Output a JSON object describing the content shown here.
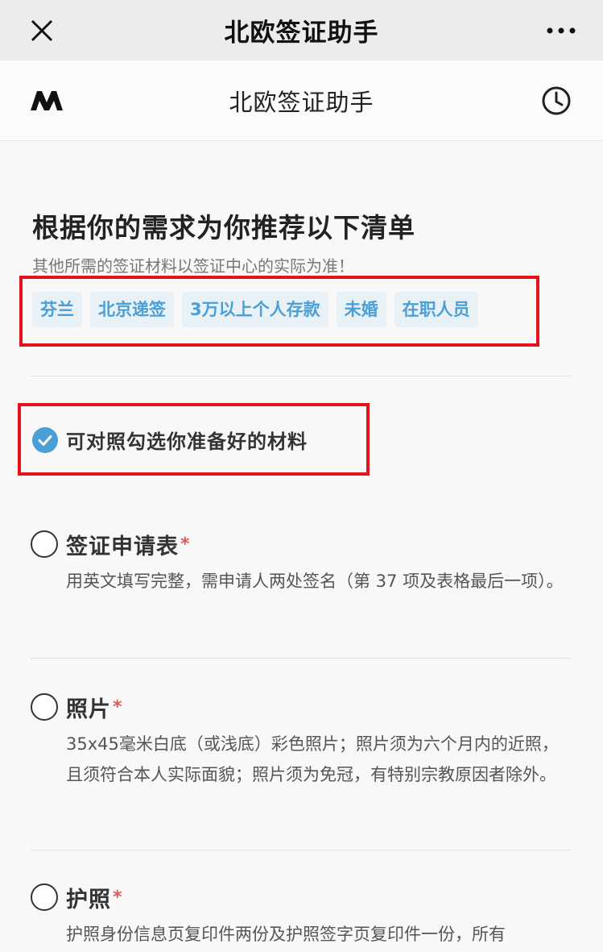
{
  "wechat_bar": {
    "title": "北欧签证助手",
    "close_icon": "close-icon",
    "more_icon": "more-icon"
  },
  "app_header": {
    "title": "北欧签证助手",
    "logo_icon": "mafengwo-logo-icon",
    "history_icon": "clock-icon"
  },
  "recommend": {
    "title": "根据你的需求为你推荐以下清单",
    "subtitle": "其他所需的签证材料以签证中心的实际为准！",
    "tags": [
      "芬兰",
      "北京递签",
      "3万以上个人存款",
      "未婚",
      "在职人员"
    ]
  },
  "hint": {
    "text": "可对照勾选你准备好的材料",
    "icon": "check-circle-icon"
  },
  "items": [
    {
      "title": "签证申请表",
      "required_mark": "*",
      "desc": "用英文填写完整，需申请人两处签名（第 37 项及表格最后一项）。"
    },
    {
      "title": "照片",
      "required_mark": "*",
      "desc": "35x45毫米白底（或浅底）彩色照片；照片须为六个月内的近照，且须符合本人实际面貌；照片须为免冠，有特别宗教原因者除外。"
    },
    {
      "title": "护照",
      "required_mark": "*",
      "desc": "护照身份信息页复印件两份及护照签字页复印件一份，所有"
    }
  ],
  "colors": {
    "accent_blue": "#4a9fd6",
    "tag_bg": "#e8f1f6",
    "highlight_red": "#e3121b",
    "required_red": "#e05a5a"
  }
}
